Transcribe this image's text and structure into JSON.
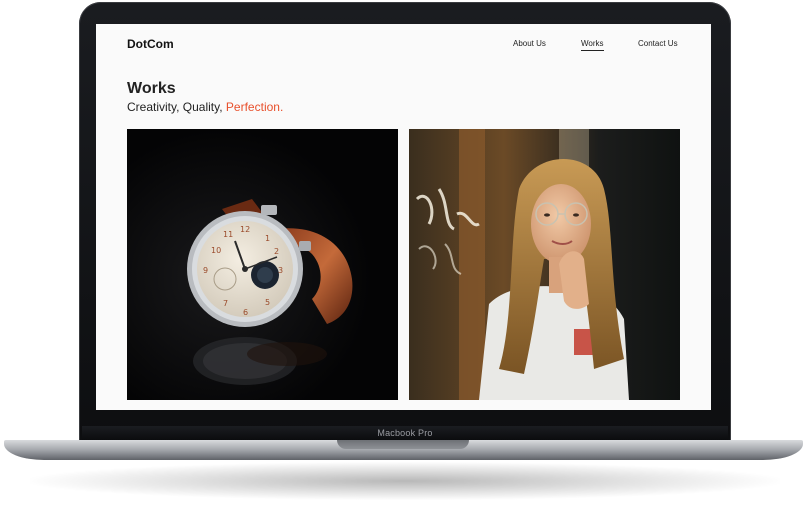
{
  "site": {
    "logo": "DotCom",
    "nav": [
      {
        "label": "About Us"
      },
      {
        "label": "Works"
      },
      {
        "label": "Contact Us"
      }
    ],
    "title": "Works",
    "tagline": {
      "text": "Creativity, Quality, ",
      "accent": "Perfection.",
      "accent_color": "#e8502c"
    },
    "gallery": [
      {
        "subject": "wristwatch-photo"
      },
      {
        "subject": "portrait-photo"
      }
    ]
  },
  "device": {
    "label": "Macbook Pro"
  }
}
